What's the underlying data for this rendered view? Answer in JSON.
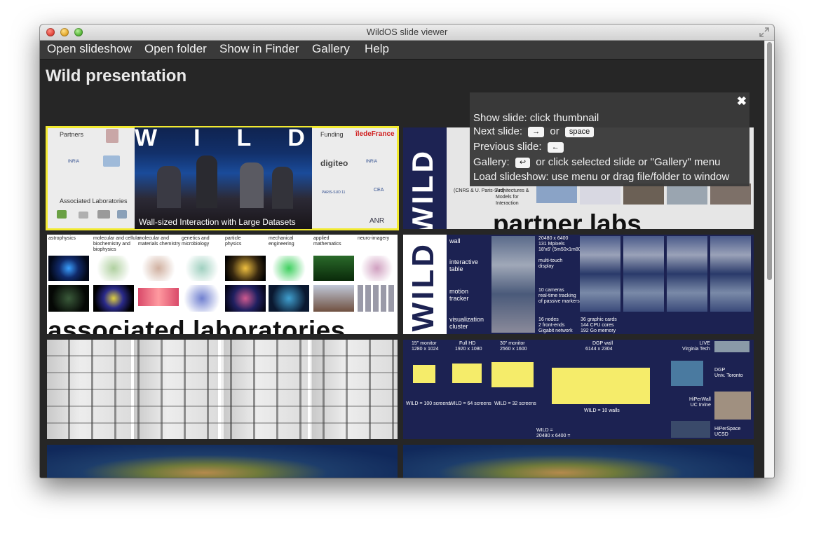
{
  "window": {
    "title": "WildOS slide viewer"
  },
  "menu": [
    "Open slideshow",
    "Open folder",
    "Show in Finder",
    "Gallery",
    "Help"
  ],
  "presentation": {
    "title": "Wild presentation"
  },
  "help": {
    "close": "✖",
    "show_slide": "Show slide: click thumbnail",
    "next_slide_prefix": "Next slide:",
    "next_key1": "→",
    "next_or": "or",
    "next_key2": "space",
    "prev_slide_prefix": "Previous slide:",
    "prev_key": "←",
    "gallery_prefix": "Gallery:",
    "gallery_key": "↩",
    "gallery_suffix": "or click selected slide or \"Gallery\" menu",
    "load": "Load slideshow: use menu or drag file/folder to window"
  },
  "slides": {
    "s1": {
      "partners": "Partners",
      "funding": "Funding",
      "wild": "WILD",
      "associated": "Associated  Laboratories",
      "caption": "Wall-sized  Interaction  with Large  Datasets",
      "ile": "îledeFrance",
      "digiteo": "digiteo",
      "inria": "INRIA",
      "cea": "CEA",
      "anr": "ANR",
      "paris_sud": "PARIS-SUD 11"
    },
    "s2": {
      "wild": "WILD",
      "cnrs": "(CNRS & U. Paris-Sud)",
      "arch": "Architectures &\nModels for\nInteraction",
      "big": "partner labs"
    },
    "s3": {
      "categories": [
        "astrophysics",
        "molecular and cellular\nbiochemistry and\nbiophysics",
        "molecular and\nmaterials chemistry",
        "genetics and\nmicrobiology",
        "particle\nphysics",
        "mechanical\nengineering",
        "applied\nmathematics",
        "neuro-imagery"
      ],
      "big": "associated laboratories"
    },
    "s4": {
      "wild": "WILD",
      "rows": [
        {
          "label": "wall",
          "spec": "20480 x 6400\n131 Mpixels\n18'x6' (5m50x1m80)"
        },
        {
          "label": "interactive\ntable",
          "spec": "multi-touch\ndisplay"
        },
        {
          "label": "motion\ntracker",
          "spec": "10 cameras\nreal-time tracking\nof passive markers"
        },
        {
          "label": "visualization\ncluster",
          "spec": "16 nodes\n2 front-ends\nGigabit network",
          "spec2": "36 graphic cards\n144 CPU cores\n192 Go memory"
        }
      ]
    },
    "s6": {
      "monitors": [
        {
          "name": "15\" monitor",
          "res": "1280 x 1024",
          "count": "WILD = 100 screens"
        },
        {
          "name": "Full HD",
          "res": "1920 x 1080",
          "count": "WILD = 64 screens"
        },
        {
          "name": "30\" monitor",
          "res": "2560 x 1600",
          "count": "WILD = 32 screens"
        },
        {
          "name": "DGP wall",
          "res": "6144 x 2304",
          "count": "WILD = 10 walls"
        }
      ],
      "total": "WILD =\n20480 x 6400 =",
      "sites": [
        {
          "name": "LIVE\nVirginia Tech"
        },
        {
          "name": "DGP\nUniv. Toronto"
        },
        {
          "name": "HiPerWall\nUC Irvine"
        },
        {
          "name": "HiPerSpace\nUCSD"
        }
      ]
    }
  },
  "colors": {
    "selection": "#f2ea30",
    "slide_navy": "#1c2252",
    "background": "#262626"
  }
}
